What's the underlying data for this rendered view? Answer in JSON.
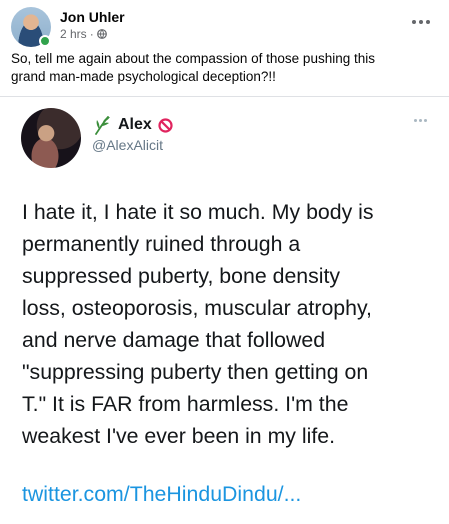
{
  "post": {
    "author": "Jon Uhler",
    "time": "2 hrs",
    "separator": "·",
    "text_lines": [
      "So, tell me again about the compassion of those pushing this",
      "grand man-made psychological deception?!!"
    ],
    "icons": {
      "visibility": "globe-icon",
      "options": "more-options-icon"
    }
  },
  "tweet": {
    "name": "Alex",
    "handle": "@AlexAlicit",
    "body_lines": [
      "I hate it, I hate it so much. My body is",
      "permanently ruined through a",
      "suppressed puberty, bone density",
      "loss, osteoporosis, muscular atrophy,",
      "and nerve damage that followed",
      "\"suppressing puberty then getting on",
      "T.\" It is FAR from harmless. I'm the",
      "weakest I've ever been in my life."
    ],
    "link": "twitter.com/TheHinduDindu/...",
    "icons": {
      "name_prefix": "leaf-icon",
      "name_suffix": "ban-icon"
    },
    "colors": {
      "link": "#1b95e0",
      "ban": "#e0245e",
      "leaf": "#3b8e3b"
    }
  }
}
